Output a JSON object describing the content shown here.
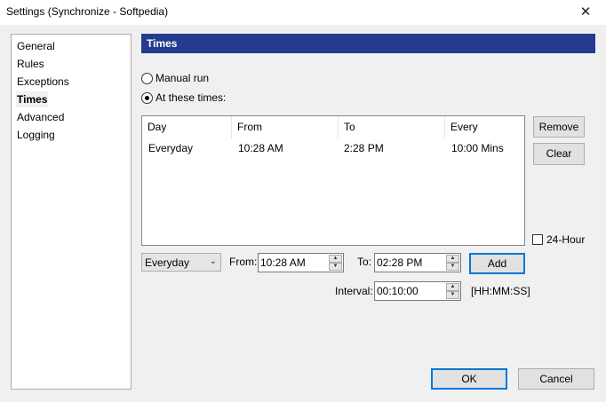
{
  "window": {
    "title": "Settings (Synchronize - Softpedia)",
    "close_glyph": "✕"
  },
  "nav": {
    "items": [
      {
        "label": "General"
      },
      {
        "label": "Rules"
      },
      {
        "label": "Exceptions"
      },
      {
        "label": "Times"
      },
      {
        "label": "Advanced"
      },
      {
        "label": "Logging"
      }
    ]
  },
  "section": {
    "title": "Times"
  },
  "mode": {
    "manual_label": "Manual run",
    "times_label": "At these times:"
  },
  "schedule_table": {
    "columns": [
      "Day",
      "From",
      "To",
      "Every"
    ],
    "rows": [
      [
        "Everyday",
        "10:28 AM",
        "2:28 PM",
        "10:00 Mins"
      ]
    ]
  },
  "buttons": {
    "remove": "Remove",
    "clear": "Clear",
    "add": "Add",
    "ok": "OK",
    "cancel": "Cancel"
  },
  "hour24": {
    "label": "24-Hour"
  },
  "editor": {
    "day_value": "Everyday",
    "from_label": "From:",
    "from_value": "10:28 AM",
    "to_label": "To:",
    "to_value": "02:28 PM",
    "interval_label": "Interval:",
    "interval_value": "00:10:00",
    "interval_hint": "[HH:MM:SS]"
  },
  "icons": {
    "chevron_down": "⌄",
    "spin_up": "▲",
    "spin_down": "▼"
  }
}
